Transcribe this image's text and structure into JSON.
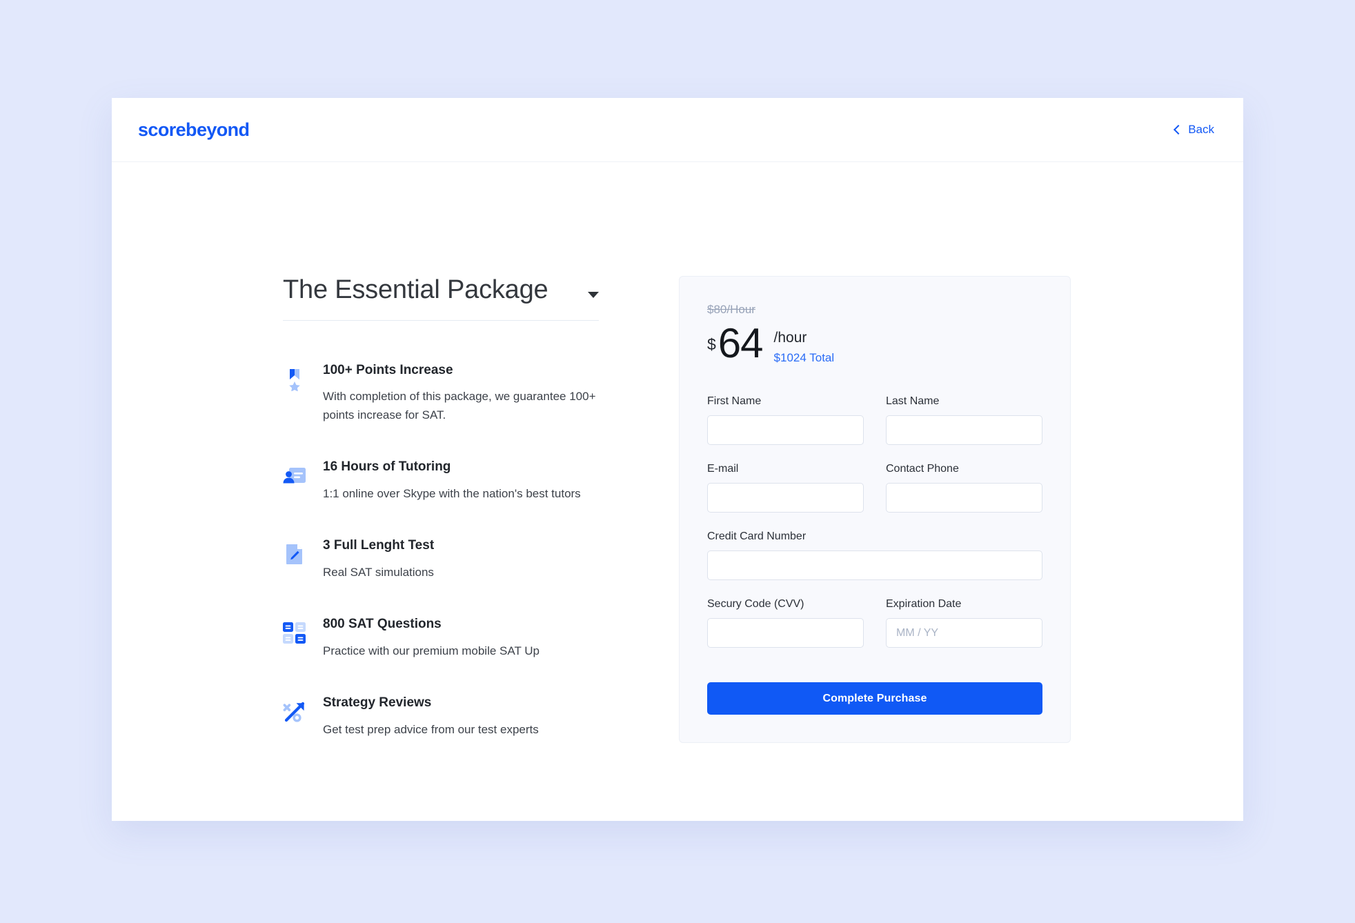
{
  "header": {
    "logo": "scorebeyond",
    "back_label": "Back"
  },
  "package": {
    "title": "The Essential Package",
    "features": [
      {
        "icon": "medal-ribbon-icon",
        "title": "100+ Points Increase",
        "desc": "With completion of this package, we guarantee 100+ points increase for SAT."
      },
      {
        "icon": "tutor-person-icon",
        "title": "16 Hours of Tutoring",
        "desc": "1:1 online over Skype with the nation's best tutors"
      },
      {
        "icon": "document-pencil-icon",
        "title": "3 Full Lenght Test",
        "desc": "Real SAT simulations"
      },
      {
        "icon": "question-cards-grid-icon",
        "title": "800 SAT Questions",
        "desc": "Practice with our premium mobile SAT Up"
      },
      {
        "icon": "strategy-arrow-icon",
        "title": "Strategy Reviews",
        "desc": "Get test prep advice from our test experts"
      }
    ]
  },
  "checkout": {
    "old_price": "$80/Hour",
    "currency_symbol": "$",
    "price": "64",
    "per_unit": "/hour",
    "total": "$1024 Total",
    "fields": {
      "first_name_label": "First Name",
      "first_name_value": "",
      "first_name_placeholder": "",
      "last_name_label": "Last Name",
      "last_name_value": "",
      "last_name_placeholder": "",
      "email_label": "E-mail",
      "email_value": "",
      "email_placeholder": "",
      "phone_label": "Contact Phone",
      "phone_value": "",
      "phone_placeholder": "",
      "card_label": "Credit Card Number",
      "card_value": "",
      "card_placeholder": "",
      "cvv_label": "Secury Code (CVV)",
      "cvv_value": "",
      "cvv_placeholder": "",
      "expiry_label": "Expiration Date",
      "expiry_value": "",
      "expiry_placeholder": "MM / YY"
    },
    "submit_label": "Complete Purchase"
  },
  "colors": {
    "brand_blue": "#1358f5",
    "button_blue": "#1059f5",
    "page_background": "#e2e8fc",
    "panel_background": "#f8f9fd",
    "link_blue": "#2a6cf6"
  }
}
